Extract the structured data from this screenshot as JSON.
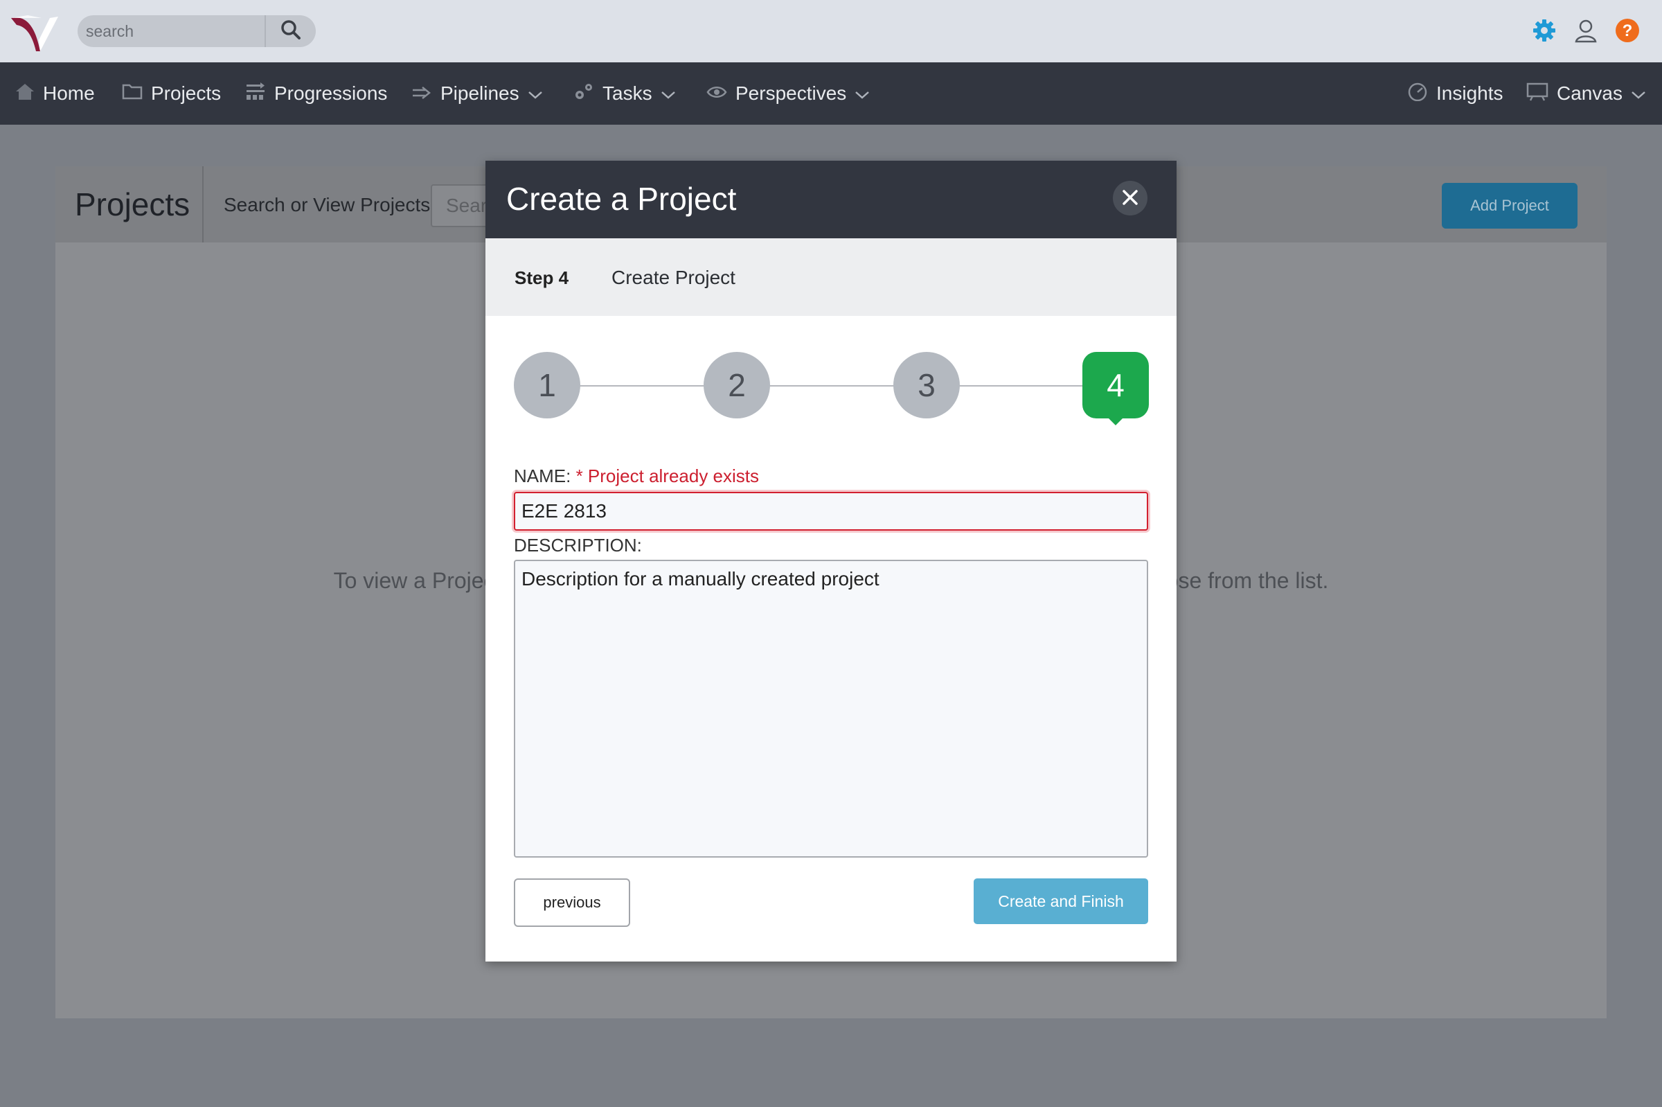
{
  "topbar": {
    "search_placeholder": "search",
    "icons": [
      "logo-mark",
      "search-icon",
      "gear-icon",
      "user-icon",
      "help-icon"
    ]
  },
  "nav": {
    "items": [
      {
        "label": "Home",
        "icon": "home-icon"
      },
      {
        "label": "Projects",
        "icon": "folder-icon"
      },
      {
        "label": "Progressions",
        "icon": "progressions-icon"
      },
      {
        "label": "Pipelines",
        "icon": "pipelines-icon",
        "dropdown": true
      },
      {
        "label": "Tasks",
        "icon": "gears-icon",
        "dropdown": true
      },
      {
        "label": "Perspectives",
        "icon": "eye-icon",
        "dropdown": true
      },
      {
        "label": "Insights",
        "icon": "gauge-icon"
      },
      {
        "label": "Canvas",
        "icon": "canvas-icon",
        "dropdown": true
      }
    ]
  },
  "page": {
    "title": "Projects",
    "search_label": "Search or View Projects:",
    "search_placeholder": "Sear",
    "add_button": "Add Project",
    "message_left": "To view a Project, p",
    "message_right": "hoose from the list."
  },
  "modal": {
    "title": "Create a Project",
    "step_number": "Step 4",
    "step_name": "Create Project",
    "steps": [
      "1",
      "2",
      "3",
      "4"
    ],
    "active_step": 4,
    "name_label": "NAME:",
    "name_error": "* Project already exists",
    "name_value": "E2E 2813",
    "description_label": "DESCRIPTION:",
    "description_value": "Description for a manually created project",
    "previous_button": "previous",
    "finish_button": "Create and Finish"
  },
  "colors": {
    "topbar": "#dde1e8",
    "navbar": "#323640",
    "overlay": "#7b7f86",
    "active_step": "#1ca84d",
    "error": "#cc1f2f",
    "primary_button": "#59afd2",
    "add_button": "#1e6c93",
    "gear_icon": "#1f9ad6",
    "help_icon": "#ef6c1c",
    "logo": "#8b1a3a"
  }
}
